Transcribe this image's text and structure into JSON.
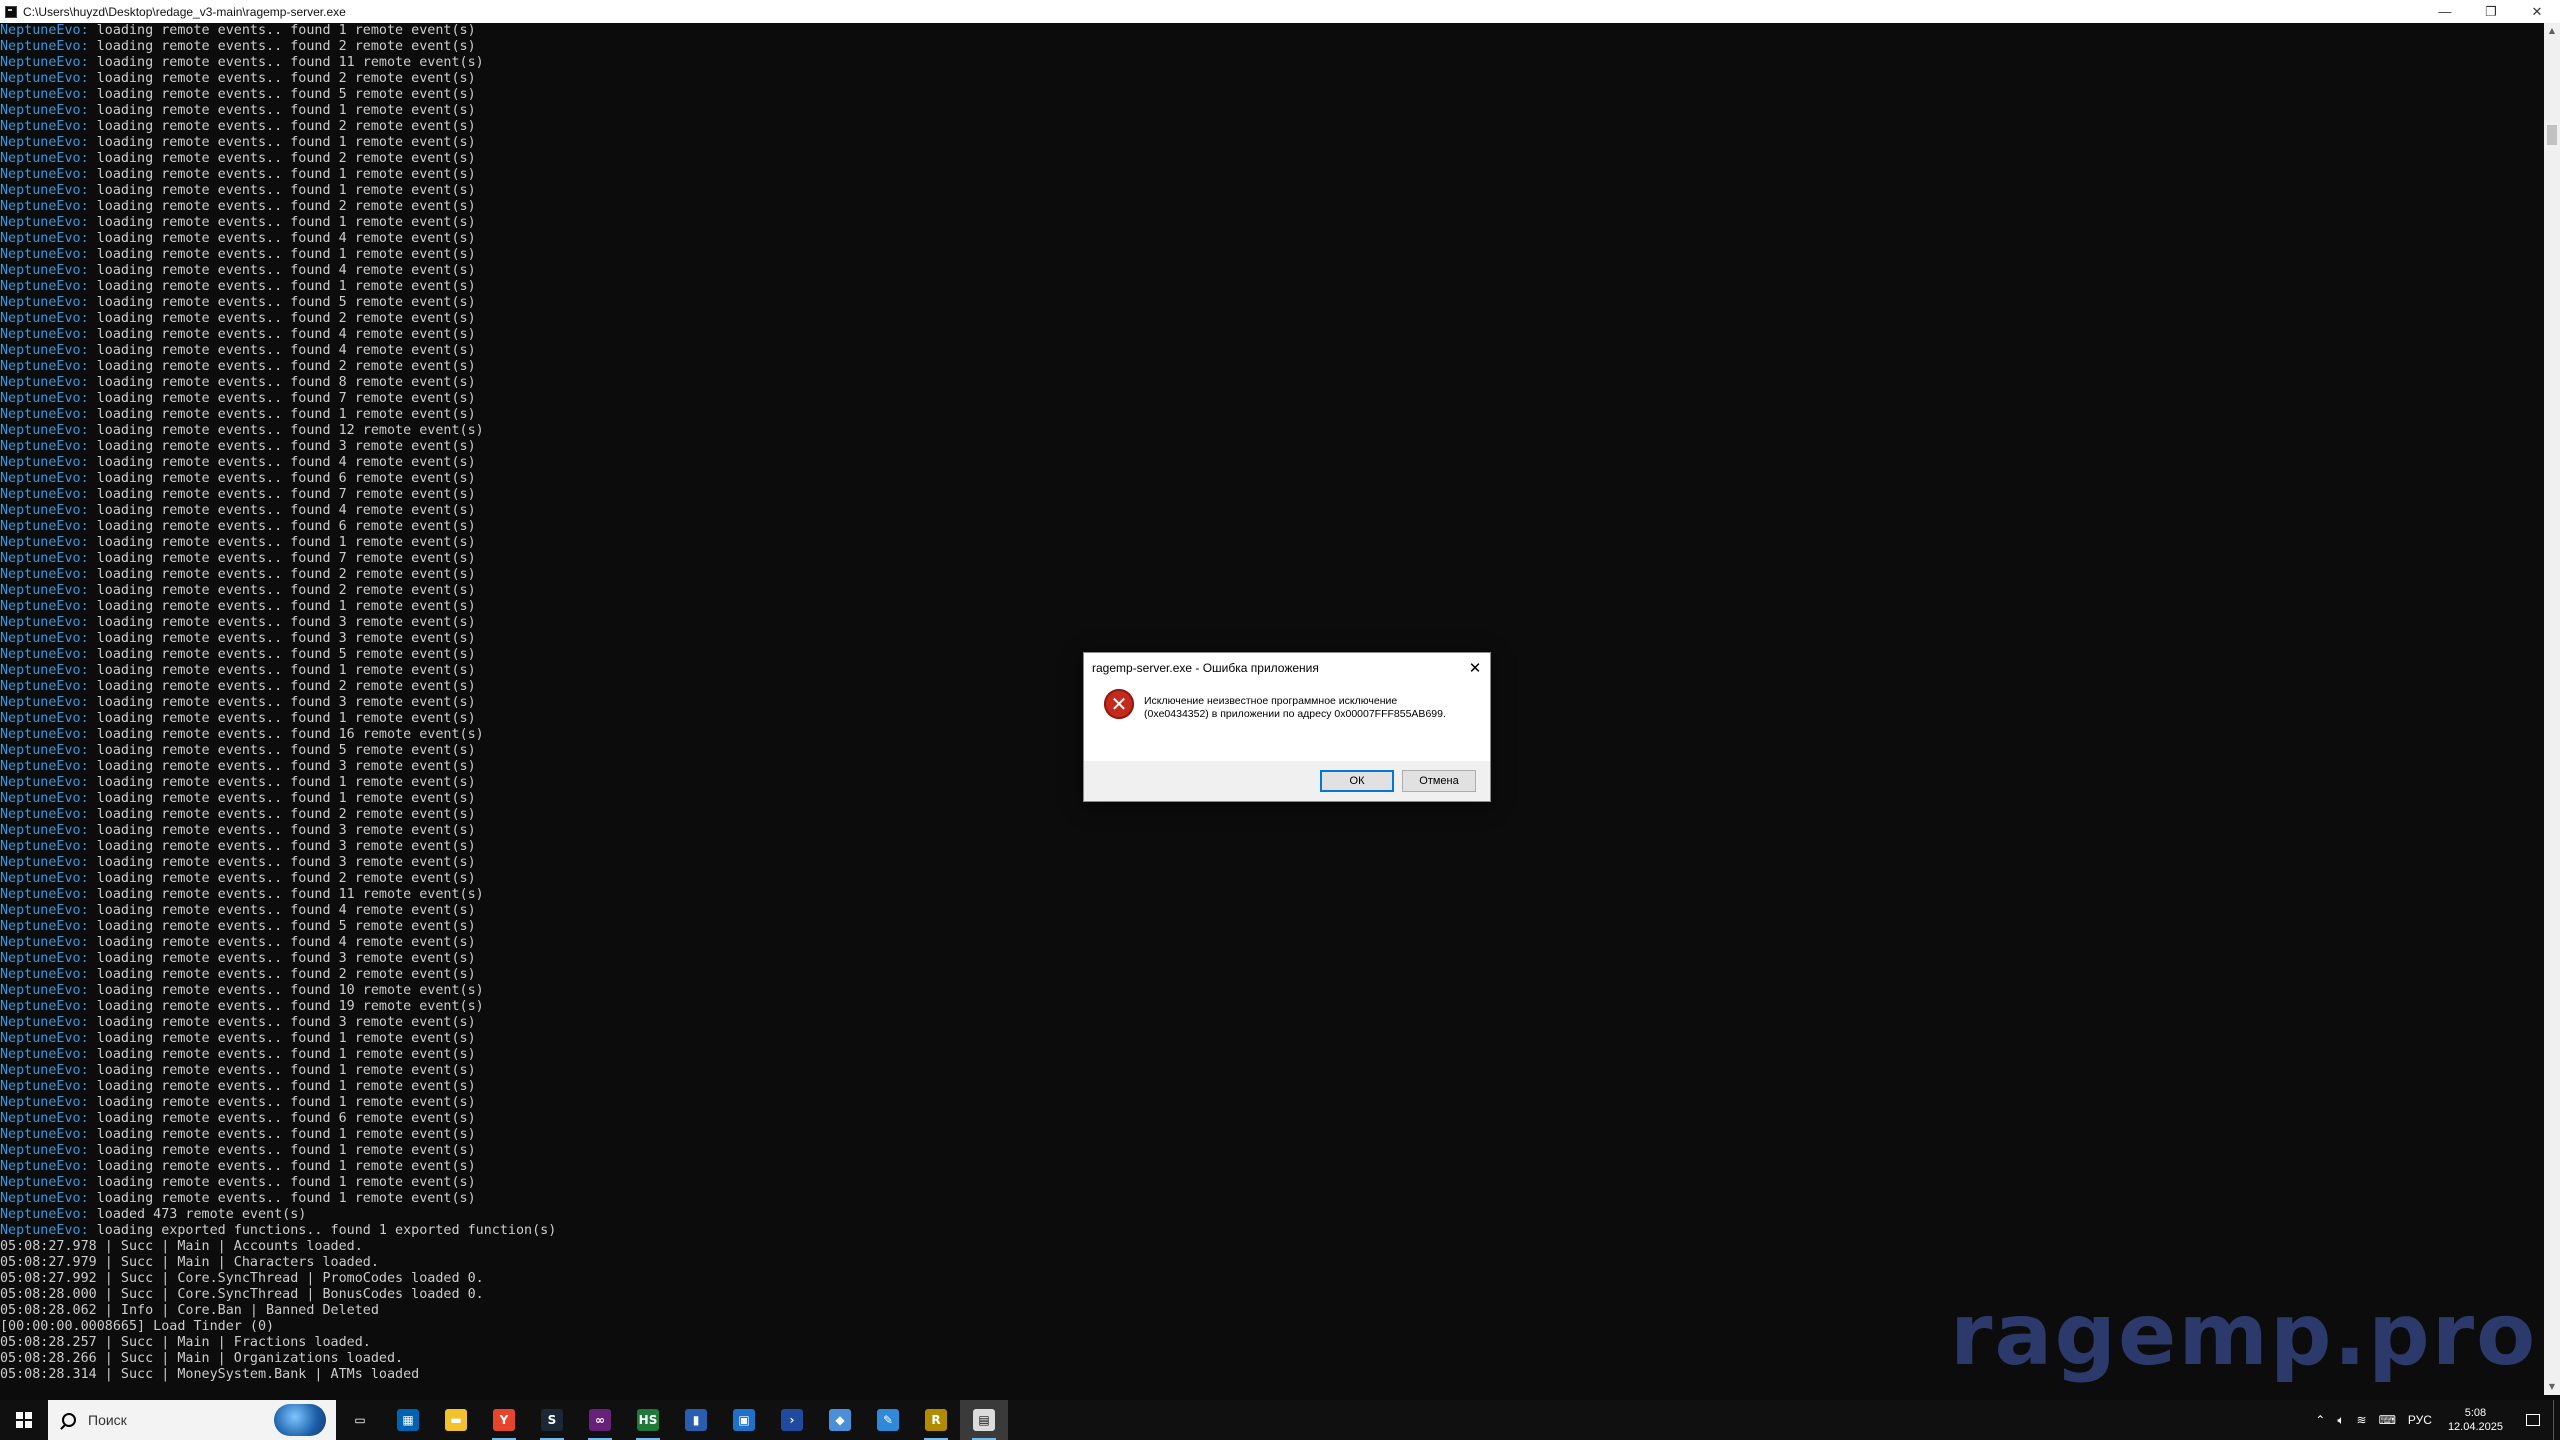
{
  "window": {
    "title": "C:\\Users\\huyzd\\Desktop\\redage_v3-main\\ragemp-server.exe",
    "minimize": "—",
    "maximize": "❐",
    "close": "✕"
  },
  "console": {
    "tag": "NeptuneEvo:",
    "remote_counts": [
      "1",
      "2",
      "11",
      "2",
      "5",
      "1",
      "2",
      "1",
      "2",
      "1",
      "1",
      "2",
      "1",
      "4",
      "1",
      "4",
      "1",
      "5",
      "2",
      "4",
      "4",
      "2",
      "8",
      "7",
      "1",
      "12",
      "3",
      "4",
      "6",
      "7",
      "4",
      "6",
      "1",
      "7",
      "2",
      "2",
      "1",
      "3",
      "3",
      "5",
      "1",
      "2",
      "3",
      "1",
      "16",
      "5",
      "3",
      "1",
      "1",
      "2",
      "3",
      "3",
      "3",
      "2",
      "11",
      "4",
      "5",
      "4",
      "3",
      "2",
      "10",
      "19",
      "3",
      "1",
      "1",
      "1",
      "1",
      "1",
      "6",
      "1",
      "1",
      "1",
      "1",
      "1"
    ],
    "loaded_line": "loaded 473 remote event(s)",
    "exported_line": "loading exported functions.. found 1 exported function(s)",
    "log_lines": [
      "05:08:27.978 | Succ | Main | Accounts loaded.",
      "05:08:27.979 | Succ | Main | Characters loaded.",
      "05:08:27.992 | Succ | Core.SyncThread | PromoCodes loaded 0.",
      "05:08:28.000 | Succ | Core.SyncThread | BonusCodes loaded 0.",
      "05:08:28.062 | Info | Core.Ban | Banned Deleted",
      "[00:00:00.0008665] Load Tinder (0)",
      "05:08:28.257 | Succ | Main | Fractions loaded.",
      "05:08:28.266 | Succ | Main | Organizations loaded.",
      "05:08:28.314 | Succ | MoneySystem.Bank | ATMs loaded"
    ]
  },
  "watermark": "ragemp.pro",
  "dialog": {
    "title": "ragemp-server.exe - Ошибка приложения",
    "close": "✕",
    "message_line1": "Исключение неизвестное программное исключение",
    "message_line2": "(0xe0434352) в приложении по адресу 0x00007FFF855AB699.",
    "ok": "ОК",
    "cancel": "Отмена"
  },
  "taskbar": {
    "search_placeholder": "Поиск",
    "apps": [
      {
        "name": "task-view-icon",
        "glyph": "▭",
        "color": "#101010"
      },
      {
        "name": "store-icon",
        "glyph": "▦",
        "color": "#0063b1"
      },
      {
        "name": "file-explorer-icon",
        "glyph": "▬",
        "color": "#f2c12e"
      },
      {
        "name": "yandex-browser-icon",
        "glyph": "Y",
        "color": "#e6452d"
      },
      {
        "name": "steam-icon",
        "glyph": "S",
        "color": "#1b2838"
      },
      {
        "name": "visual-studio-icon",
        "glyph": "∞",
        "color": "#68217a"
      },
      {
        "name": "hs-app-icon",
        "glyph": "HS",
        "color": "#1f7a3a"
      },
      {
        "name": "chart-app-icon",
        "glyph": "▮",
        "color": "#2a5db0"
      },
      {
        "name": "monitor-app-icon",
        "glyph": "▣",
        "color": "#1e70c8"
      },
      {
        "name": "powershell-icon",
        "glyph": "›",
        "color": "#1f4aa0"
      },
      {
        "name": "tool-app-icon",
        "glyph": "◆",
        "color": "#4a8fd8"
      },
      {
        "name": "editor-app-icon",
        "glyph": "✎",
        "color": "#2f88d8"
      },
      {
        "name": "ragemp-icon",
        "glyph": "R",
        "color": "#b38b00"
      },
      {
        "name": "console-app-icon",
        "glyph": "▤",
        "color": "#dcdcdc"
      }
    ],
    "tray": {
      "language": "РУС",
      "time": "5:08",
      "date": "12.04.2025"
    }
  }
}
